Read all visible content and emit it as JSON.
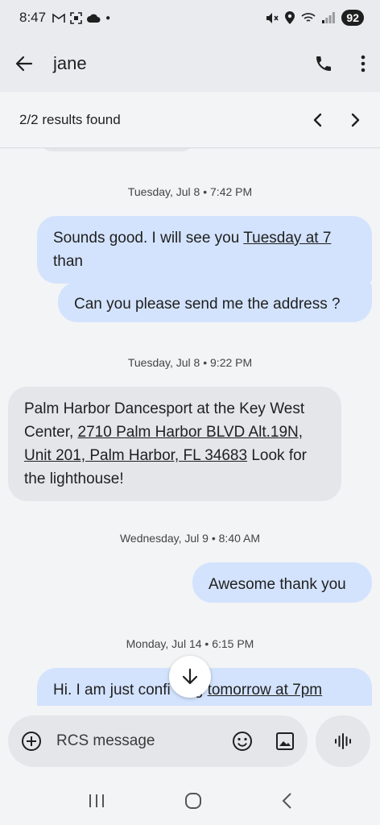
{
  "status_bar": {
    "time": "8:47",
    "icons_left": [
      "gmail-icon",
      "screenshot-icon",
      "cloud-icon",
      "dot"
    ],
    "icons_right": [
      "mute-icon",
      "location-icon",
      "wifi-icon",
      "signal-icon"
    ],
    "battery": "92"
  },
  "app_bar": {
    "contact_name": "jane"
  },
  "search": {
    "results_text": "2/2 results found"
  },
  "messages": [
    {
      "timestamp": "Tuesday, Jul 8 • 7:42 PM"
    },
    {
      "direction": "outgoing",
      "text_before": "Sounds good. I will see you ",
      "link": "Tuesday at 7",
      "text_after": " than"
    },
    {
      "direction": "outgoing",
      "text": "Can you please send me the address ?"
    },
    {
      "timestamp": "Tuesday, Jul 8 • 9:22 PM"
    },
    {
      "direction": "incoming",
      "text_before": "Palm Harbor Dancesport at the Key West Center, ",
      "link": "2710 Palm Harbor BLVD Alt.19N, Unit 201, Palm Harbor, FL 34683",
      "text_after": " Look for the lighthouse!"
    },
    {
      "timestamp": "Wednesday, Jul 9 • 8:40 AM"
    },
    {
      "direction": "outgoing",
      "text": "Awesome thank you"
    },
    {
      "timestamp": "Monday, Jul 14 • 6:15 PM"
    },
    {
      "direction": "outgoing",
      "text_before": "Hi. I am just confi",
      "text_mid": "g ",
      "link": "tomorrow at 7pm"
    }
  ],
  "composer": {
    "placeholder": "RCS message"
  },
  "colors": {
    "outgoing_bubble": "#d3e3fd",
    "incoming_bubble": "#e4e6ea",
    "background": "#f3f4f6"
  }
}
